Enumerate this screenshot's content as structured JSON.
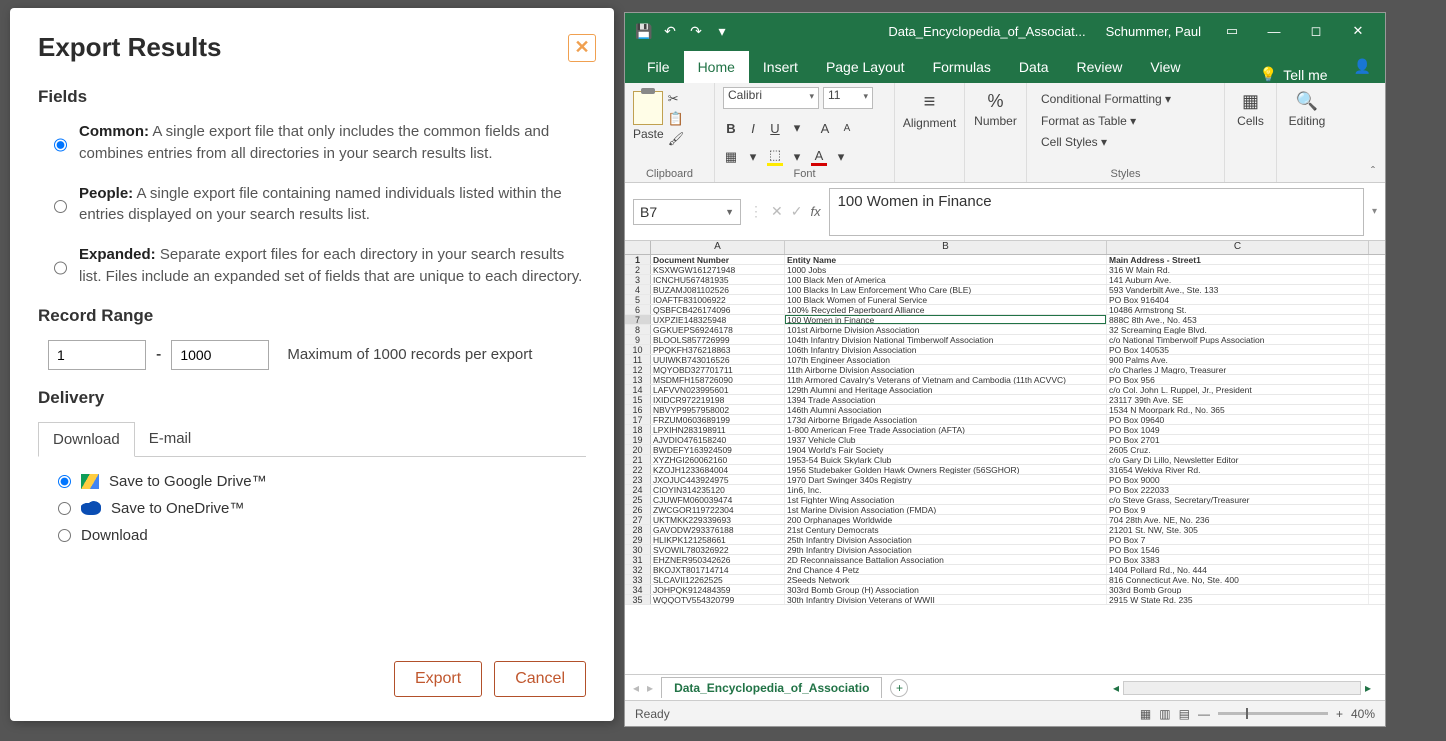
{
  "modal": {
    "title": "Export Results",
    "fields_heading": "Fields",
    "options": [
      {
        "label": "Common:",
        "desc": "A single export file that only includes the common fields and combines entries from all directories in your search results list.",
        "checked": true
      },
      {
        "label": "People:",
        "desc": "A single export file containing named individuals listed within the entries displayed on your search results list.",
        "checked": false
      },
      {
        "label": "Expanded:",
        "desc": "Separate export files for each directory in your search results list. Files include an expanded set of fields that are unique to each directory.",
        "checked": false
      }
    ],
    "range_heading": "Record Range",
    "range_from": "1",
    "range_to": "1000",
    "range_note": "Maximum of 1000 records per export",
    "delivery_heading": "Delivery",
    "tabs": [
      "Download",
      "E-mail"
    ],
    "del_opts": [
      {
        "label": "Save to Google Drive™",
        "checked": true
      },
      {
        "label": "Save to OneDrive™",
        "checked": false
      },
      {
        "label": "Download",
        "checked": false
      }
    ],
    "export_btn": "Export",
    "cancel_btn": "Cancel"
  },
  "excel": {
    "doc_title": "Data_Encyclopedia_of_Associat...",
    "user": "Schummer, Paul",
    "ribbon_tabs": [
      "File",
      "Home",
      "Insert",
      "Page Layout",
      "Formulas",
      "Data",
      "Review",
      "View"
    ],
    "tellme": "Tell me",
    "font_name": "Calibri",
    "font_size": "11",
    "groups": {
      "clipboard": "Clipboard",
      "font": "Font",
      "alignment": "Alignment",
      "number": "Number",
      "styles": "Styles",
      "cells": "Cells",
      "editing": "Editing",
      "paste": "Paste"
    },
    "style_items": [
      "Conditional Formatting ▾",
      "Format as Table ▾",
      "Cell Styles ▾"
    ],
    "namebox": "B7",
    "formula": "100 Women in Finance",
    "col_headers": [
      "A",
      "B",
      "C"
    ],
    "header_row": [
      "Document Number",
      "Entity Name",
      "Main Address - Street1"
    ],
    "rows": [
      [
        "KSXWGW161271948",
        "1000 Jobs",
        "316 W Main Rd."
      ],
      [
        "ICNCHU567481935",
        "100 Black Men of America",
        "141 Auburn Ave."
      ],
      [
        "BUZAMJ081102526",
        "100 Blacks In Law Enforcement Who Care (BLE)",
        "593 Vanderbilt Ave., Ste. 133"
      ],
      [
        "IOAFTF831006922",
        "100 Black Women of Funeral Service",
        "PO Box 916404"
      ],
      [
        "QSBFCB426174096",
        "100% Recycled Paperboard Alliance",
        "10486 Armstrong St."
      ],
      [
        "UXPZIE148325948",
        "100 Women in Finance",
        "888C 8th Ave., No. 453"
      ],
      [
        "GGKUEPS69246178",
        "101st Airborne Division Association",
        "32 Screaming Eagle Blvd."
      ],
      [
        "BLOOLS857726999",
        "104th Infantry Division National Timberwolf Association",
        "c/o National Timberwolf Pups Association"
      ],
      [
        "PPQKFH376218863",
        "106th Infantry Division Association",
        "PO Box 140535"
      ],
      [
        "UUIWKB743016526",
        "107th Engineer Association",
        "900 Palms Ave."
      ],
      [
        "MQYOBD327701711",
        "11th Airborne Division Association",
        "c/o Charles J Magro, Treasurer"
      ],
      [
        "MSDMFH158726090",
        "11th Armored Cavalry's Veterans of Vietnam and Cambodia (11th ACVVC)",
        "PO Box 956"
      ],
      [
        "LAFVVN023995601",
        "129th Alumni and Heritage Association",
        "c/o Col. John L. Ruppel, Jr., President"
      ],
      [
        "IXIDCR972219198",
        "1394 Trade Association",
        "23117 39th Ave. SE"
      ],
      [
        "NBVYP9957958002",
        "146th Alumni Association",
        "1534 N Moorpark Rd., No. 365"
      ],
      [
        "FRZUM0603689199",
        "173d Airborne Brigade Association",
        "PO Box 09640"
      ],
      [
        "LPXIHN283198911",
        "1-800 American Free Trade Association (AFTA)",
        "PO Box 1049"
      ],
      [
        "AJVDIO476158240",
        "1937 Vehicle Club",
        "PO Box 2701"
      ],
      [
        "BWDEFY163924509",
        "1904 World's Fair Society",
        "2605 Cruz."
      ],
      [
        "XYZHGI260062160",
        "1953-54 Buick Skylark Club",
        "c/o Gary Di Lillo, Newsletter Editor"
      ],
      [
        "KZOJH1233684004",
        "1956 Studebaker Golden Hawk Owners Register (56SGHOR)",
        "31654 Wekiva River Rd."
      ],
      [
        "JXOJUC443924975",
        "1970 Dart Swinger 340s Registry",
        "PO Box 9000"
      ],
      [
        "CIOYIN314235120",
        "1in6, Inc.",
        "PO Box 222033"
      ],
      [
        "CJUWFM060039474",
        "1st Fighter Wing Association",
        "c/o Steve Grass, Secretary/Treasurer"
      ],
      [
        "ZWCGOR119722304",
        "1st Marine Division Association (FMDA)",
        "PO Box 9"
      ],
      [
        "UKTMKK229339693",
        "200 Orphanages Worldwide",
        "704 28th Ave. NE, No. 236"
      ],
      [
        "GAVODW293376188",
        "21st Century Democrats",
        "21201 St. NW, Ste. 305"
      ],
      [
        "HLIKPK121258661",
        "25th Infantry Division Association",
        "PO Box 7"
      ],
      [
        "SVOWIL780326922",
        "29th Infantry Division Association",
        "PO Box 1546"
      ],
      [
        "EHZNER950342626",
        "2D Reconnaissance Battalion Association",
        "PO Box 3383"
      ],
      [
        "BKOJXT801714714",
        "2nd Chance 4 Petz",
        "1404 Pollard Rd., No. 444"
      ],
      [
        "SLCAVII12262525",
        "2Seeds Network",
        "816 Connecticut Ave. No, Ste. 400"
      ],
      [
        "JOHPQK912484359",
        "303rd Bomb Group (H) Association",
        "303rd Bomb Group"
      ],
      [
        "WQQOTV554320799",
        "30th Infantry Division Veterans of WWII",
        "2915 W State Rd. 235"
      ]
    ],
    "selected_row_index": 6,
    "sheet_name": "Data_Encyclopedia_of_Associatio",
    "status": "Ready",
    "zoom": "40%"
  }
}
